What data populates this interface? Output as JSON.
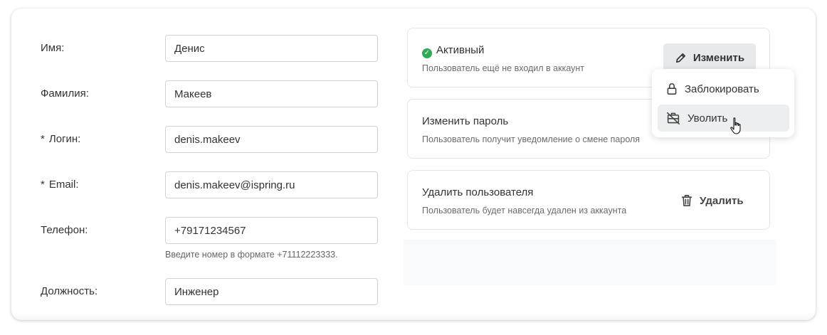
{
  "form": {
    "fields": [
      {
        "label": "Имя:",
        "required": false,
        "value": "Денис"
      },
      {
        "label": "Фамилия:",
        "required": false,
        "value": "Макеев"
      },
      {
        "label": "Логин:",
        "required": true,
        "value": "denis.makeev"
      },
      {
        "label": "Email:",
        "required": true,
        "value": "denis.makeev@ispring.ru"
      },
      {
        "label": "Телефон:",
        "required": false,
        "value": "+79171234567",
        "hint": "Введите номер в формате +71112223333."
      },
      {
        "label": "Должность:",
        "required": false,
        "value": "Инженер"
      }
    ],
    "required_marker": "*"
  },
  "status_panel": {
    "status": "Активный",
    "status_color": "#2faa55",
    "subtitle": "Пользователь ещё не входил в аккаунт",
    "edit_button": "Изменить",
    "edit_icon": "pencil-icon"
  },
  "password_panel": {
    "title": "Изменить пароль",
    "subtitle": "Пользователь получит уведомление о смене пароля"
  },
  "delete_panel": {
    "title": "Удалить пользователя",
    "subtitle": "Пользователь будет навсегда удален из аккаунта",
    "delete_button": "Удалить",
    "delete_icon": "trash-icon"
  },
  "dropdown": {
    "items": [
      {
        "label": "Заблокировать",
        "icon": "lock-icon"
      },
      {
        "label": "Уволить",
        "icon": "dismiss-briefcase-icon",
        "hovered": true
      }
    ]
  }
}
